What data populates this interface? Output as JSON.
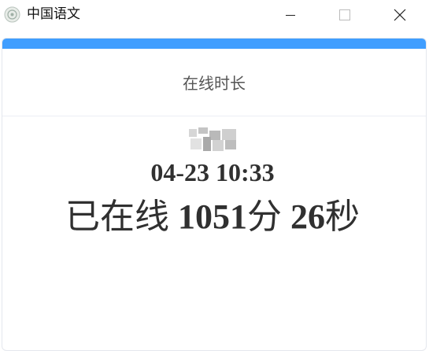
{
  "window": {
    "title": "中国语文",
    "app_icon": "app-logo-icon",
    "controls": [
      "minimize-icon",
      "maximize-icon",
      "close-icon"
    ]
  },
  "card": {
    "accent_color": "#409eff",
    "title": "在线时长",
    "user_name_icon": "blurred-name",
    "datetime": "04-23 10:33",
    "online": {
      "prefix": "已在线 ",
      "minutes": "1051",
      "minutes_unit": "分 ",
      "seconds": "26",
      "seconds_unit": "秒"
    }
  }
}
